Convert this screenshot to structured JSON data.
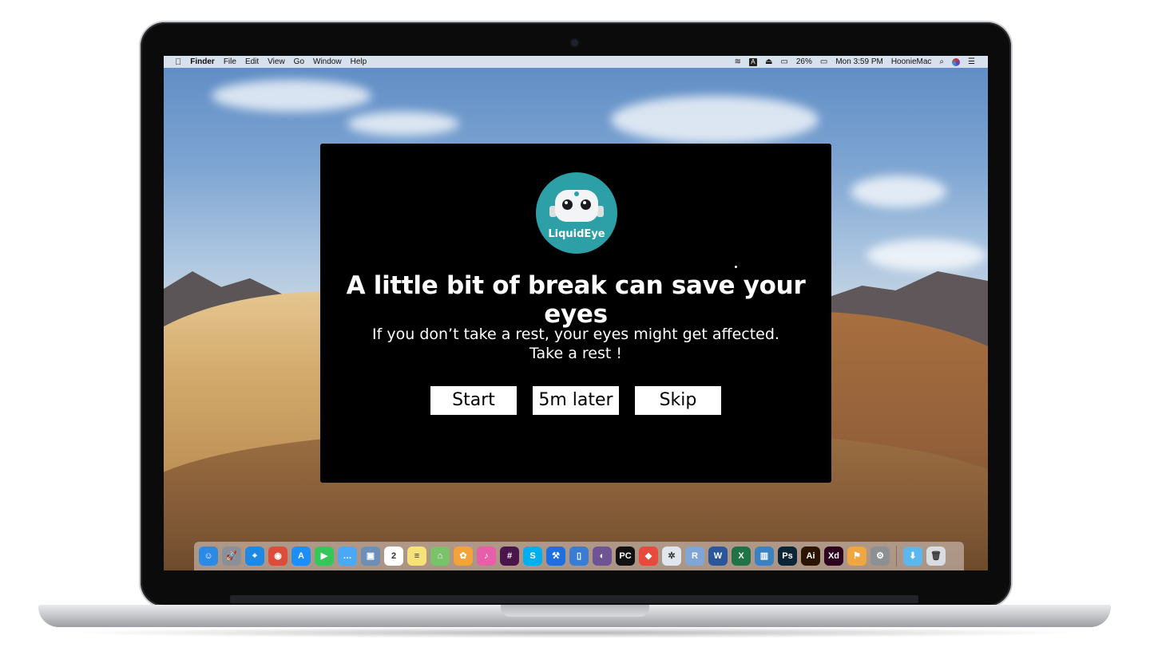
{
  "menubar": {
    "app_name": "Finder",
    "menus": [
      "File",
      "Edit",
      "View",
      "Go",
      "Window",
      "Help"
    ],
    "battery": "26%",
    "datetime": "Mon 3:59 PM",
    "user": "HoonieMac",
    "input_source": "A"
  },
  "modal": {
    "logo_text": "LiquidEye",
    "headline": "A little bit of break can save your eyes",
    "message_line1": "If you don’t take a rest, your eyes might get affected.",
    "message_line2": "Take a rest !",
    "start_label": "Start",
    "later_label": "5m later",
    "skip_label": "Skip"
  },
  "dock": {
    "apps": [
      {
        "name": "finder",
        "glyph": "☺",
        "color": "#2b8ae6"
      },
      {
        "name": "launchpad",
        "glyph": "🚀",
        "color": "#8a8f99"
      },
      {
        "name": "safari",
        "glyph": "⌖",
        "color": "#1e88e5"
      },
      {
        "name": "chrome",
        "glyph": "◉",
        "color": "#dd4b39"
      },
      {
        "name": "app-store",
        "glyph": "A",
        "color": "#1c8ef9"
      },
      {
        "name": "facetime",
        "glyph": "▶",
        "color": "#35c759"
      },
      {
        "name": "messages",
        "glyph": "…",
        "color": "#4aa8f5"
      },
      {
        "name": "preview",
        "glyph": "▣",
        "color": "#6b8fb8"
      },
      {
        "name": "calendar",
        "glyph": "2",
        "color": "#ffffff"
      },
      {
        "name": "notes",
        "glyph": "≡",
        "color": "#f7e27a"
      },
      {
        "name": "maps",
        "glyph": "⌂",
        "color": "#7ac36a"
      },
      {
        "name": "photos",
        "glyph": "✿",
        "color": "#f2a33a"
      },
      {
        "name": "itunes",
        "glyph": "♪",
        "color": "#e85ea8"
      },
      {
        "name": "slack",
        "glyph": "#",
        "color": "#4a154b"
      },
      {
        "name": "skype",
        "glyph": "S",
        "color": "#00aff0"
      },
      {
        "name": "xcode",
        "glyph": "⚒",
        "color": "#1d6fe0"
      },
      {
        "name": "simulator",
        "glyph": "▯",
        "color": "#3a7bd5"
      },
      {
        "name": "github",
        "glyph": "◐",
        "color": "#6e5494"
      },
      {
        "name": "pycharm",
        "glyph": "PC",
        "color": "#111111"
      },
      {
        "name": "git-client",
        "glyph": "◆",
        "color": "#e84a3b"
      },
      {
        "name": "network-tool",
        "glyph": "✲",
        "color": "#dfe6ee"
      },
      {
        "name": "r-lang",
        "glyph": "R",
        "color": "#7fa6d6"
      },
      {
        "name": "word",
        "glyph": "W",
        "color": "#2b579a"
      },
      {
        "name": "excel",
        "glyph": "X",
        "color": "#217346"
      },
      {
        "name": "file-manager",
        "glyph": "▥",
        "color": "#3b82c4"
      },
      {
        "name": "photoshop",
        "glyph": "Ps",
        "color": "#0b2436"
      },
      {
        "name": "illustrator",
        "glyph": "Ai",
        "color": "#2b1500"
      },
      {
        "name": "adobe-xd",
        "glyph": "Xd",
        "color": "#2e001f"
      },
      {
        "name": "fish-app",
        "glyph": "⚑",
        "color": "#f0a742"
      },
      {
        "name": "system-preferences",
        "glyph": "⚙",
        "color": "#8c8f94"
      }
    ],
    "right": [
      {
        "name": "downloads-folder",
        "glyph": "⬇",
        "color": "#5cb8ec"
      },
      {
        "name": "trash",
        "glyph": "🗑",
        "color": "#d9dde2"
      }
    ]
  }
}
